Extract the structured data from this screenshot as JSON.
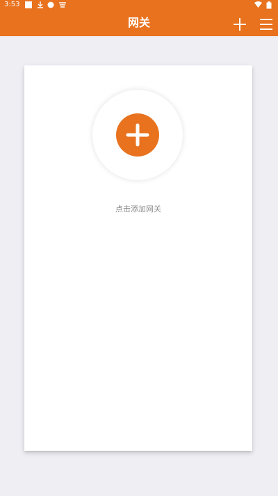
{
  "status_bar": {
    "time": "3:53",
    "icons": [
      "square-icon",
      "download-icon",
      "badge-icon",
      "notification-icon",
      "wifi-icon",
      "battery-icon"
    ]
  },
  "header": {
    "title": "网关",
    "add_icon": "plus-icon",
    "menu_icon": "menu-icon"
  },
  "main": {
    "add_gateway_icon": "plus-circle-icon",
    "hint": "点击添加网关"
  },
  "colors": {
    "accent": "#E8721E",
    "background": "#EEEEF3",
    "card": "#FFFFFF",
    "hint_text": "#8A8A8A"
  }
}
